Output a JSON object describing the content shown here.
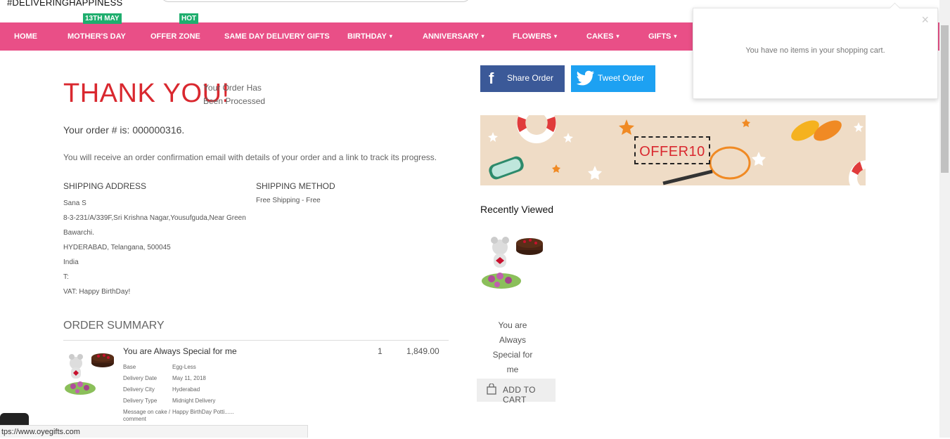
{
  "header": {
    "tagline": "#DELIVERINGHAPPINESS"
  },
  "nav": {
    "items": [
      {
        "label": "HOME"
      },
      {
        "label": "MOTHER'S DAY",
        "badge": "13TH MAY"
      },
      {
        "label": "OFFER ZONE",
        "badge": "HOT"
      },
      {
        "label": "SAME DAY DELIVERY GIFTS"
      },
      {
        "label": "BIRTHDAY"
      },
      {
        "label": "ANNIVERSARY"
      },
      {
        "label": "FLOWERS"
      },
      {
        "label": "CAKES"
      },
      {
        "label": "GIFTS"
      }
    ],
    "chevron": "▾",
    "colors": {
      "bar": "#e94f87",
      "badge": "#1fae6e"
    }
  },
  "order": {
    "thanks_title": "THANK YOU!",
    "thanks_sub": "Your Order Has Been Processed",
    "order_number_text": "Your order # is: 000000316.",
    "confirmation_text": "You will receive an order confirmation email with details of your order and a link to track its progress."
  },
  "shipping_address": {
    "heading": "SHIPPING ADDRESS",
    "lines": [
      "Sana S",
      "8-3-231/A/339F,Sri Krishna Nagar,Yousufguda,Near Green Bawarchi.",
      "HYDERABAD, Telangana, 500045",
      "India",
      "T:",
      "VAT: Happy BirthDay!"
    ]
  },
  "shipping_method": {
    "heading": "SHIPPING METHOD",
    "value": "Free Shipping - Free"
  },
  "order_summary": {
    "title": "ORDER SUMMARY",
    "item": {
      "name": "You are Always Special for me",
      "qty": "1",
      "price": "1,849.00",
      "options": [
        {
          "key": "Base",
          "value": "Egg-Less"
        },
        {
          "key": "Delivery Date",
          "value": "May 11, 2018"
        },
        {
          "key": "Delivery City",
          "value": "Hyderabad"
        },
        {
          "key": "Delivery Type",
          "value": "Midnight Delivery"
        },
        {
          "key": "Message on cake / comment",
          "value": "Happy BirthDay Potti......"
        }
      ]
    }
  },
  "share": {
    "facebook_label": "Share Order",
    "twitter_label": "Tweet Order",
    "colors": {
      "facebook": "#3b5998",
      "twitter": "#1da1f2"
    }
  },
  "promo_banner": {
    "coupon_code": "OFFER10"
  },
  "recently_viewed": {
    "title": "Recently Viewed",
    "product_name": "You are Always Special for me",
    "add_to_cart_label": "ADD TO CART"
  },
  "cart_popup": {
    "close_glyph": "×",
    "empty_message": "You have no items in your shopping cart."
  },
  "status_bar": {
    "url": "tps://www.oyegifts.com"
  }
}
